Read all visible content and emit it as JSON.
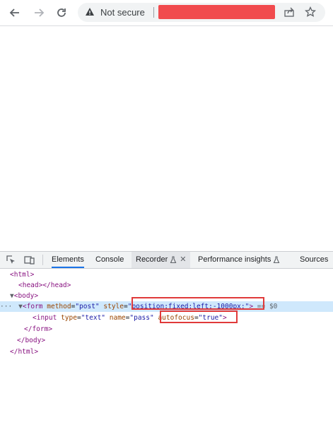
{
  "browser": {
    "security_label": "Not secure",
    "icons": [
      "back-arrow-icon",
      "forward-arrow-icon",
      "reload-icon",
      "warning-icon",
      "share-icon",
      "star-icon"
    ],
    "redaction_color": "#f14b4e"
  },
  "devtools": {
    "tabs": [
      {
        "label": "Elements",
        "active": true
      },
      {
        "label": "Console",
        "active": false
      },
      {
        "label": "Recorder",
        "active": false
      },
      {
        "label": "Performance insights",
        "active": false
      },
      {
        "label": "Sources",
        "active": false
      }
    ],
    "dom": {
      "html_open": "<html>",
      "head": "<head></head>",
      "body_open": "<body>",
      "form_tag": "form",
      "form_attr1_name": "method",
      "form_attr1_val": "\"post\"",
      "form_attr2_name": "style",
      "form_attr2_val": "\"position:fixed;left:-1000px;\"",
      "form_suffix": " == $0",
      "input_tag": "input",
      "input_attr1_name": "type",
      "input_attr1_val": "\"text\"",
      "input_attr2_name": "name",
      "input_attr2_val": "\"pass\"",
      "input_attr3_name": "autofocus",
      "input_attr3_val": "\"true\"",
      "form_close": "</form>",
      "body_close": "</body>",
      "html_close": "</html>"
    },
    "highlight_color": "#e03a3a"
  }
}
